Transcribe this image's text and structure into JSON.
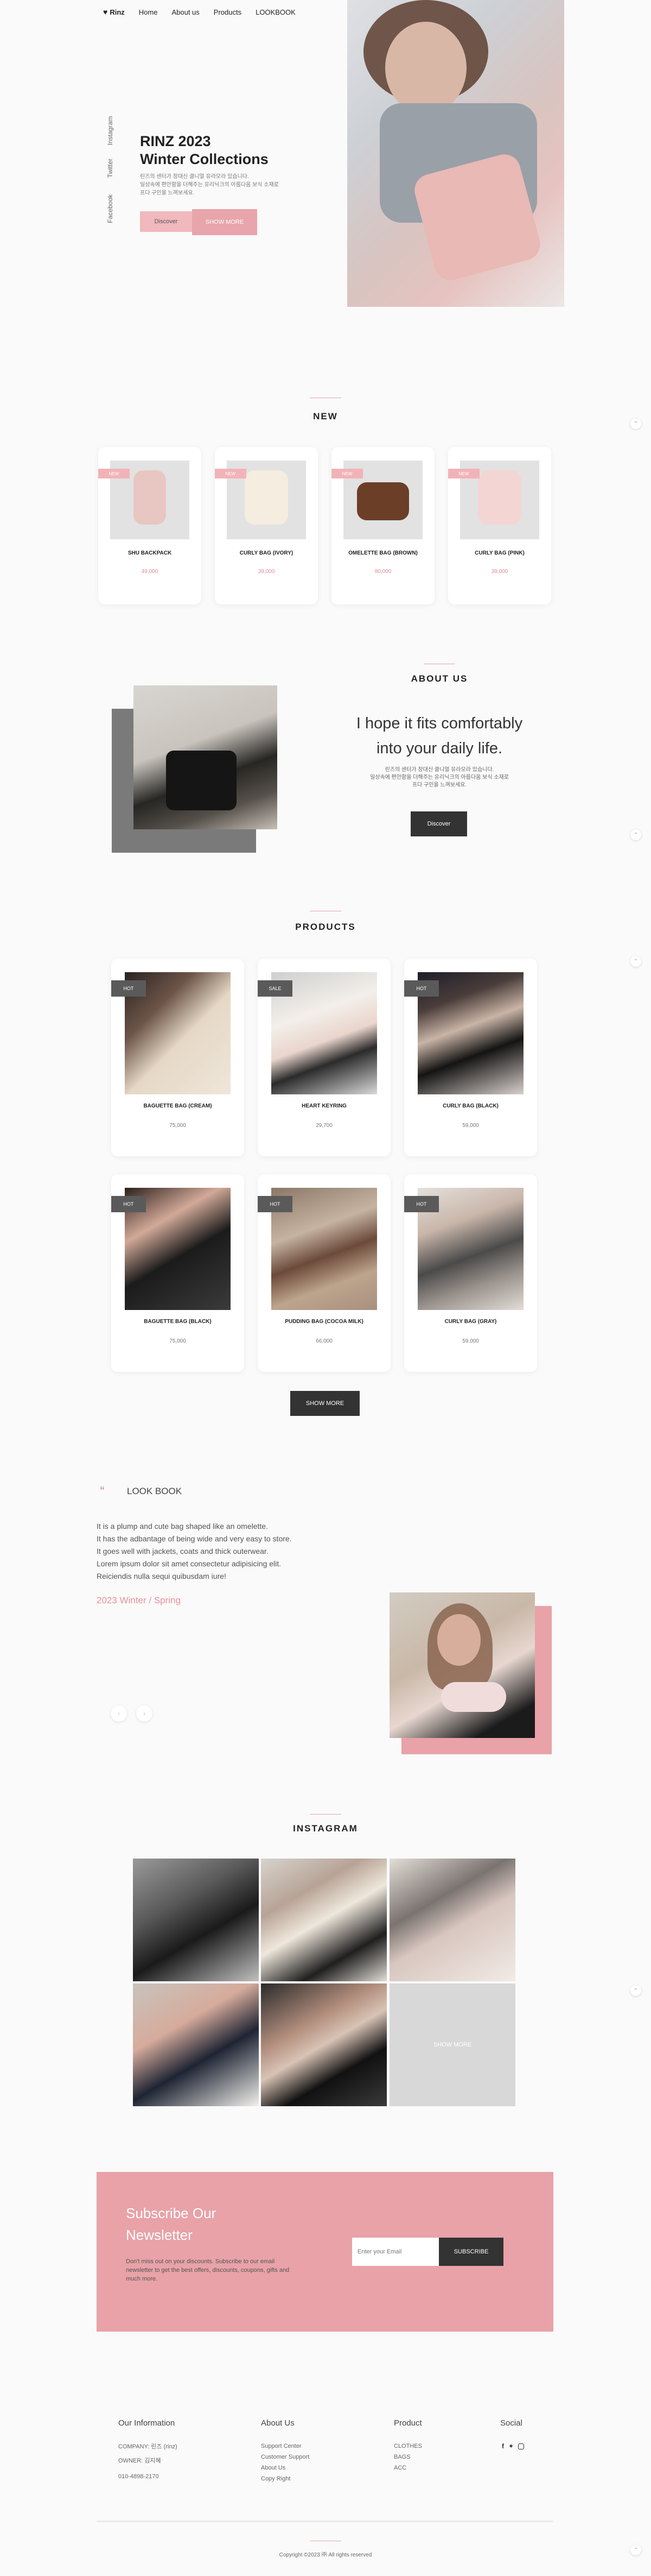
{
  "header": {
    "logo": "Rinz",
    "nav": [
      "Home",
      "About us",
      "Products",
      "LOOKBOOK"
    ]
  },
  "hero": {
    "social": [
      "Instagram",
      "Twitter",
      "Facebook"
    ],
    "title_line1": "RINZ 2023",
    "title_line2": "Winter Collections",
    "desc_line1": "린즈의 센터가 창대신 클니얼 유라모라 있습니다.",
    "desc_line2": "일상속에 편안함을 더해주는 유리닉크의 아름다움 보식 소재로",
    "desc_line3": "프다 구인을 느껴보세요.",
    "discover": "Discover",
    "show_more": "SHOW MORE"
  },
  "new_section": {
    "title": "NEW",
    "items": [
      {
        "tag": "NEW",
        "name": "SHU BACKPACK",
        "price": "49,000",
        "color": "#e8c6c2"
      },
      {
        "tag": "NEW",
        "name": "CURLY BAG (IVORY)",
        "price": "39,000",
        "color": "#f4ede0"
      },
      {
        "tag": "NEW",
        "name": "OMELETTE BAG (BROWN)",
        "price": "80,000",
        "color": "#6b3e28"
      },
      {
        "tag": "NEW",
        "name": "CURLY BAG (PINK)",
        "price": "39,000",
        "color": "#f3d6d4"
      }
    ]
  },
  "about": {
    "title": "ABOUT US",
    "quote_line1": "I hope it fits comfortably",
    "quote_line2": "into your daily life.",
    "desc_line1": "린즈의 센터가 창대신 클니얼 유라모라 있습니다.",
    "desc_line2": "일상속에 편안함을 더해주는 유리닉크의 아름다움 보식 소재로",
    "desc_line3": "프다 구인을 느껴보세요.",
    "button": "Discover"
  },
  "products_section": {
    "title": "PRODUCTS",
    "items": [
      {
        "tag": "HOT",
        "name": "BAGUETTE BAG (CREAM)",
        "price": "75,000"
      },
      {
        "tag": "SALE",
        "name": "HEART KEYRING",
        "price": "29,700"
      },
      {
        "tag": "HOT",
        "name": "CURLY BAG (BLACK)",
        "price": "59,000"
      },
      {
        "tag": "HOT",
        "name": "BAGUETTE BAG (BLACK)",
        "price": "75,000"
      },
      {
        "tag": "HOT",
        "name": "PUDDING BAG (COCOA MILK)",
        "price": "66,000"
      },
      {
        "tag": "HOT",
        "name": "CURLY BAG (GRAY)",
        "price": "59,000"
      }
    ],
    "show_more": "SHOW MORE"
  },
  "lookbook": {
    "quote_mark": "“",
    "title": "LOOK BOOK",
    "lines": [
      "It is a plump and cute bag shaped like an omelette.",
      "It has the adbantage of being wide and very easy to store.",
      "It goes well with jackets, coats and thick outerwear.",
      "Lorem ipsum dolor sit amet consectetur adipisicing elit.",
      "Reiciendis nulla sequi quibusdam iure!"
    ],
    "subtitle": "2023 Winter / Spring",
    "prev": "‹",
    "next": "›"
  },
  "instagram": {
    "title": "INSTAGRAM",
    "show_more": "SHOW MORE"
  },
  "newsletter": {
    "title_line1": "Subscribe Our",
    "title_line2": "Newsletter",
    "text_line1": "Don't miss out on your discounts. Subscribe to our email",
    "text_line2": "newsletter to get the best offers, discounts, coupons, gifts and",
    "text_line3": "much more.",
    "placeholder": "Enter your Email",
    "button": "SUBSCRIBE"
  },
  "footer": {
    "info_title": "Our Information",
    "info": [
      "COMPANY: 린즈 (rinz)",
      "OWNER: 김지혜",
      "010-4898-2170"
    ],
    "about_title": "About Us",
    "about": [
      "Support Center",
      "Customer Support",
      "About Us",
      "Copy Right"
    ],
    "product_title": "Product",
    "product": [
      "CLOTHES",
      "BAGS",
      "ACC"
    ],
    "social_title": "Social",
    "copyright": "Copyright ©2023 ㈜ All rights reserved"
  }
}
